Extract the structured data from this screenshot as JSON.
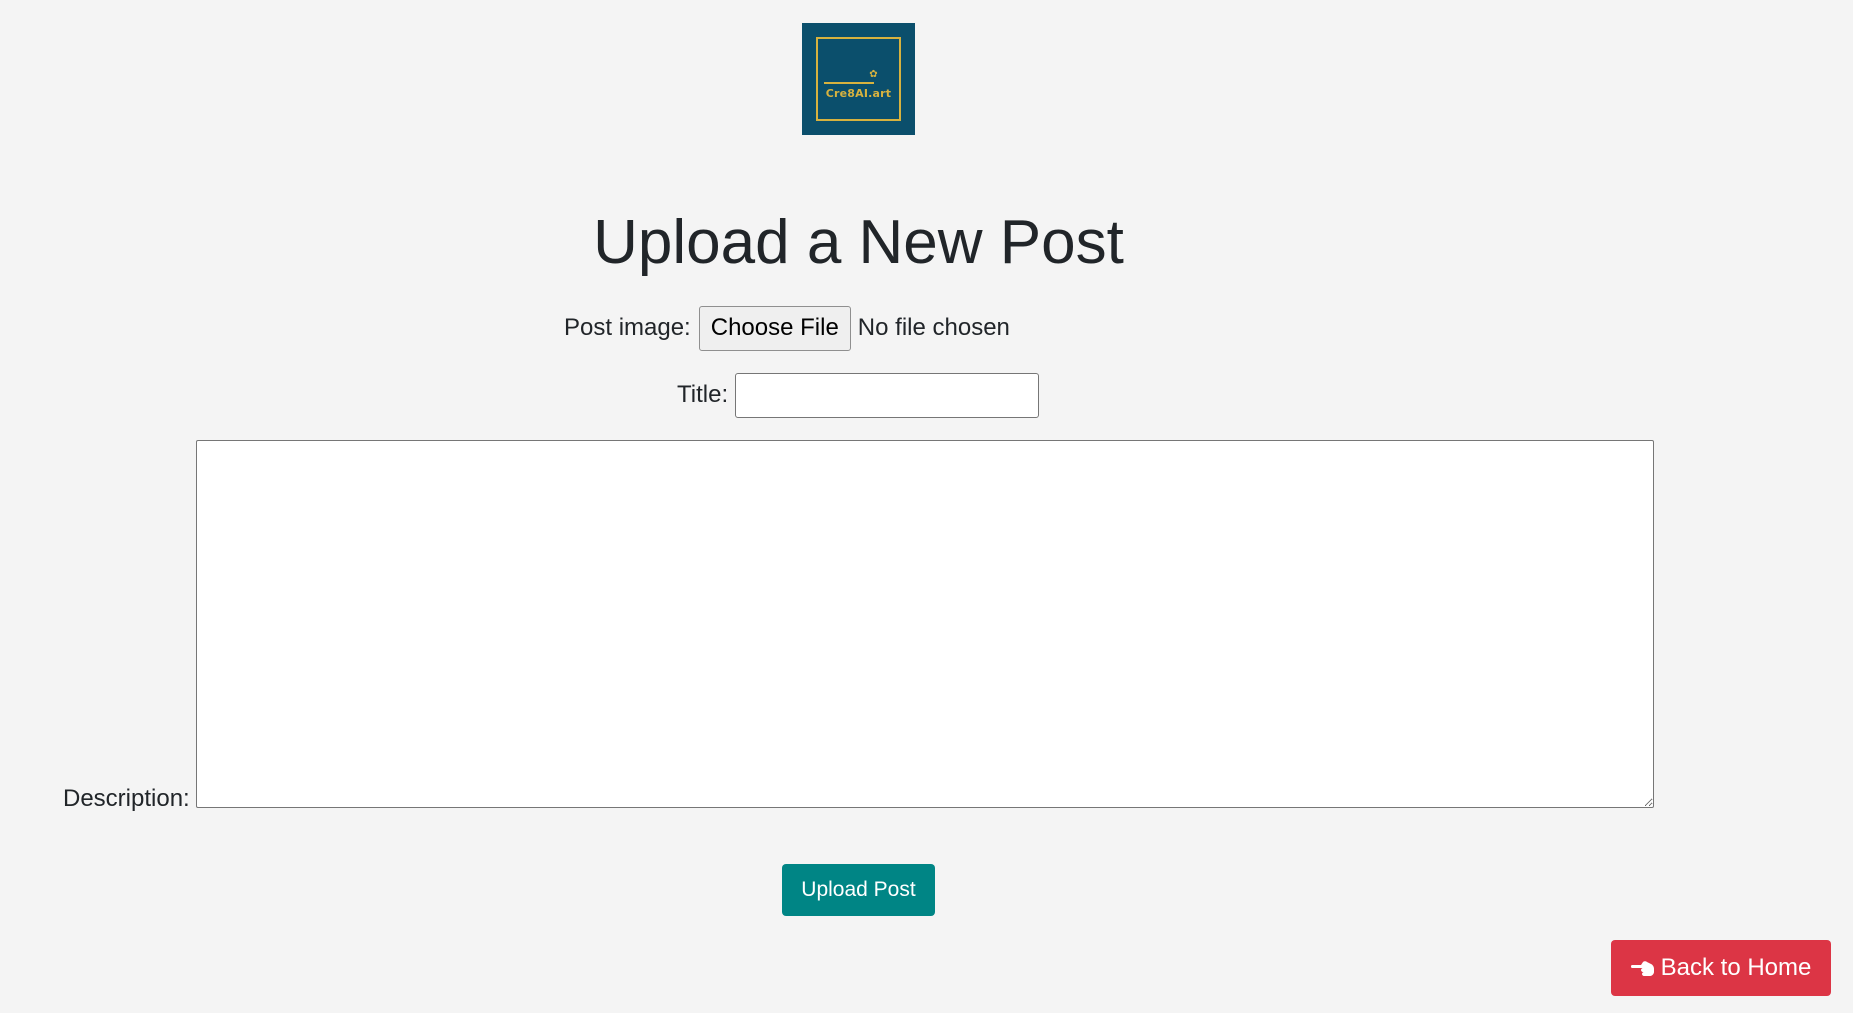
{
  "logo": {
    "text": "Cre8AI.art",
    "icon": "palette-icon",
    "background": "#0b4f6c",
    "accent": "#d7b23f"
  },
  "page": {
    "title": "Upload a New Post"
  },
  "form": {
    "image_label": "Post image:",
    "file_button_label": "Choose File",
    "file_status": "No file chosen",
    "title_label": "Title:",
    "title_value": "",
    "description_label": "Description:",
    "description_value": "",
    "submit_label": "Upload Post"
  },
  "footer": {
    "back_label": "Back to Home",
    "back_icon": "hand-pointing-left-icon"
  },
  "colors": {
    "submit": "#008585",
    "back": "#dc3545",
    "background": "#f4f4f4"
  }
}
